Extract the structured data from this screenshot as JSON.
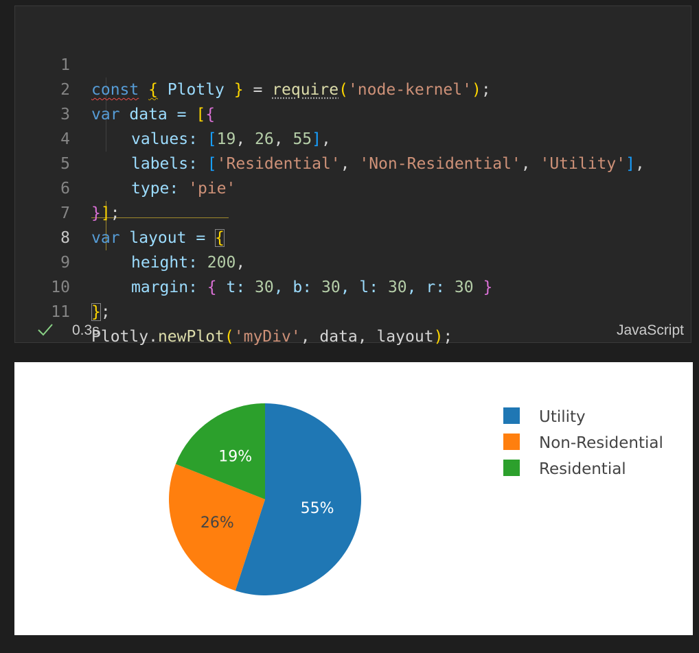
{
  "editor": {
    "line_numbers": [
      "1",
      "2",
      "3",
      "4",
      "5",
      "6",
      "7",
      "8",
      "9",
      "10",
      "11"
    ],
    "active_line": "8",
    "code": {
      "l1": {
        "kw": "const",
        "open": "{",
        "name": " Plotly ",
        "close": "}",
        "eq": " = ",
        "fn": "require",
        "po": "(",
        "str": "'node-kernel'",
        "pc": ")",
        "end": ";"
      },
      "l2": {
        "kw": "var",
        "name": " data = ",
        "b1": "[",
        "b2": "{"
      },
      "l3": {
        "key": "values: ",
        "bo": "[",
        "n1": "19",
        "s1": ", ",
        "n2": "26",
        "s2": ", ",
        "n3": "55",
        "bc": "]",
        "end": ","
      },
      "l4": {
        "key": "labels: ",
        "bo": "[",
        "s1": "'Residential'",
        "c1": ", ",
        "s2": "'Non-Residential'",
        "c2": ", ",
        "s3": "'Utility'",
        "bc": "]",
        "end": ","
      },
      "l5": {
        "key": "type: ",
        "str": "'pie'"
      },
      "l6": {
        "b2": "}",
        "b1": "]",
        "end": ";"
      },
      "l7": {
        "kw": "var",
        "name": " layout = ",
        "open": "{"
      },
      "l8": {
        "key": "height: ",
        "num": "200",
        "end": ","
      },
      "l9": {
        "key": "margin: ",
        "open": "{",
        "t": " t: ",
        "tv": "30",
        "b": ", b: ",
        "bv": "30",
        "l": ", l: ",
        "lv": "30",
        "r": ", r: ",
        "rv": "30",
        "sp": " ",
        "close": "}"
      },
      "l10": {
        "close": "}",
        "end": ";"
      },
      "l11": {
        "obj": "Plotly",
        "dot": ".",
        "fn": "newPlot",
        "po": "(",
        "str": "'myDiv'",
        "args": ", data, layout",
        "pc": ")",
        "end": ";"
      }
    }
  },
  "status": {
    "check_icon": "check-icon",
    "time": "0.3s",
    "language": "JavaScript"
  },
  "chart_data": {
    "type": "pie",
    "labels": [
      "Utility",
      "Non-Residential",
      "Residential"
    ],
    "values": [
      55,
      26,
      19
    ],
    "percent_labels": [
      "55%",
      "26%",
      "19%"
    ],
    "colors": [
      "#1f77b4",
      "#ff7f0e",
      "#2ca02c"
    ],
    "label_colors": [
      "#ffffff",
      "#444444",
      "#ffffff"
    ],
    "legend": [
      "Utility",
      "Non-Residential",
      "Residential"
    ],
    "legend_placement": "top-right",
    "sort": "descending, clockwise from 12 o'clock"
  }
}
